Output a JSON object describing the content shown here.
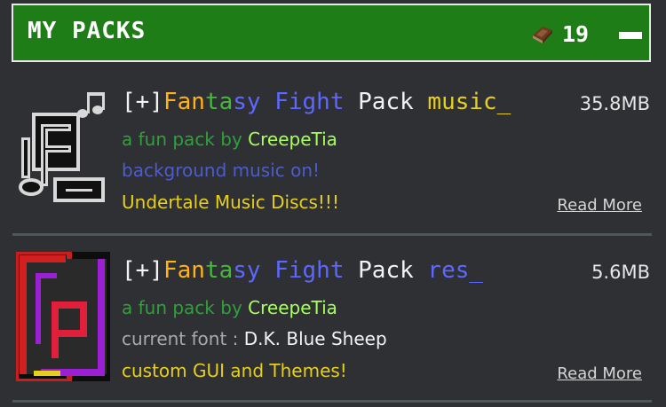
{
  "header": {
    "title": "MY PACKS",
    "count": "19",
    "icons": {
      "count": "book-icon",
      "collapse": "minus-icon"
    }
  },
  "packs": [
    {
      "title_parts": [
        "[+]",
        "Fan",
        "ta",
        "sy",
        " Fight",
        " Pack",
        " music_"
      ],
      "line1_parts": [
        "a fun pack by ",
        "CreepeTia"
      ],
      "line2": "background music on!",
      "line3": "Undertale Music Discs!!!",
      "size": "35.8MB",
      "read_more": "Read More"
    },
    {
      "title_parts": [
        "[+]",
        "Fan",
        "ta",
        "sy",
        " Fight",
        " Pack",
        " res_"
      ],
      "line1_parts": [
        "a fun pack by ",
        "CreepeTia"
      ],
      "line2_parts": [
        "current font : ",
        "D.K. Blue Sheep"
      ],
      "line3": "custom GUI and Themes!",
      "size": "5.6MB",
      "read_more": "Read More"
    }
  ],
  "colors": {
    "header_green": "#1f7d17",
    "background": "#2f3033",
    "orange": "#ffb21b",
    "green": "#47b83e",
    "blue": "#5c68ff",
    "yellow": "#e6cf1d"
  }
}
